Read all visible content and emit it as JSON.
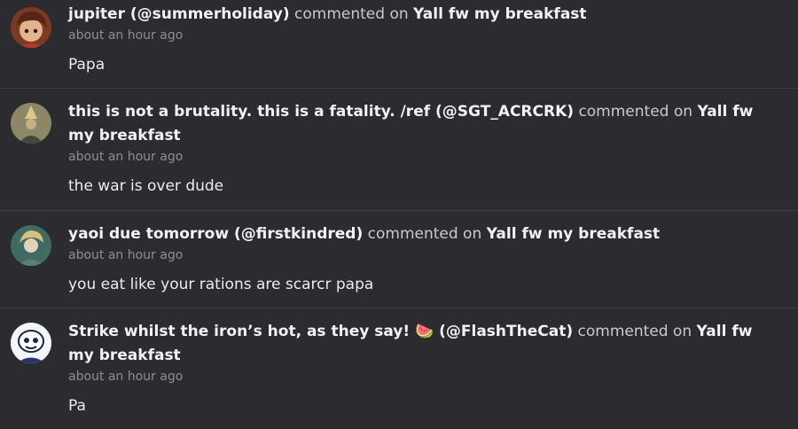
{
  "comments": [
    {
      "user_display": "jupiter (@summerholiday)",
      "action": "commented on",
      "post_title": "Yall fw my breakfast",
      "timestamp": "about an hour ago",
      "text": "Papa"
    },
    {
      "user_display": "this is not a brutality. this is a fatality. /ref (@SGT_ACRCRK)",
      "action": "commented on",
      "post_title": "Yall fw my breakfast",
      "timestamp": "about an hour ago",
      "text": "the war is over dude"
    },
    {
      "user_display": "yaoi due tomorrow (@firstkindred)",
      "action": "commented on",
      "post_title": "Yall fw my breakfast",
      "timestamp": "about an hour ago",
      "text": "you eat like your rations are scarcr papa"
    },
    {
      "user_display": "Strike whilst the iron’s hot, as they say! 🍉 (@FlashTheCat)",
      "action": "commented on",
      "post_title": "Yall fw my breakfast",
      "timestamp": "about an hour ago",
      "text": "Pa"
    }
  ]
}
